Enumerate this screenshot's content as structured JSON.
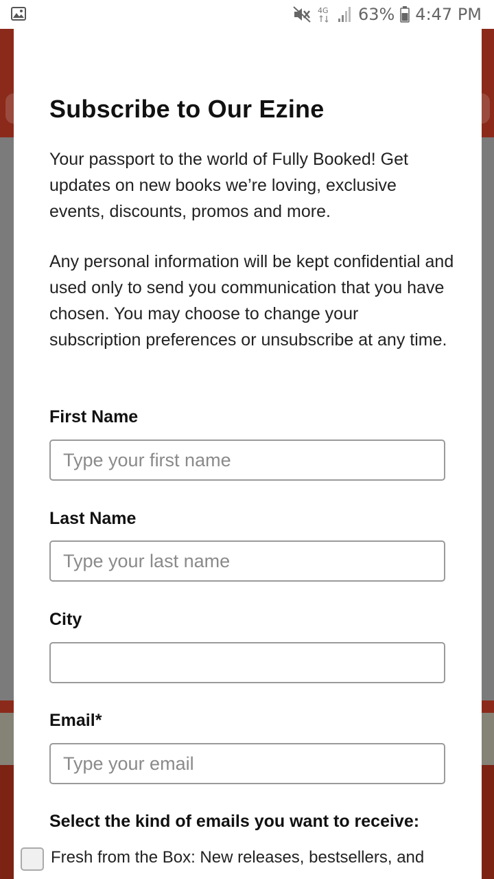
{
  "status_bar": {
    "battery": "63%",
    "time": "4:47 PM",
    "network": "4G",
    "icons": [
      "gallery-icon",
      "mute-icon",
      "network-4g-icon",
      "signal-icon",
      "battery-icon"
    ]
  },
  "modal": {
    "title": "Subscribe to Our Ezine",
    "intro": "Your passport to the world of Fully Booked! Get updates on new books we’re loving, exclusive events, discounts, promos and more.",
    "privacy": "Any personal information will be kept confidential and used only to send you communication that you have chosen. You may choose to change your subscription preferences or unsubscribe at any time.",
    "first_name": {
      "label": "First Name",
      "placeholder": "Type your first name",
      "value": ""
    },
    "last_name": {
      "label": "Last Name",
      "placeholder": "Type your last name",
      "value": ""
    },
    "city": {
      "label": "City",
      "placeholder": "",
      "value": ""
    },
    "email": {
      "label": "Email*",
      "placeholder": "Type your email",
      "value": ""
    },
    "email_types_heading": "Select the kind of emails you want to receive:",
    "options": [
      {
        "label": "Fresh from the Box: New releases, bestsellers, and",
        "checked": false
      }
    ]
  },
  "colors": {
    "overlay_red": "#8b2a1a",
    "overlay_gray": "#7b7b7b",
    "field_border": "#9a9a9a"
  }
}
